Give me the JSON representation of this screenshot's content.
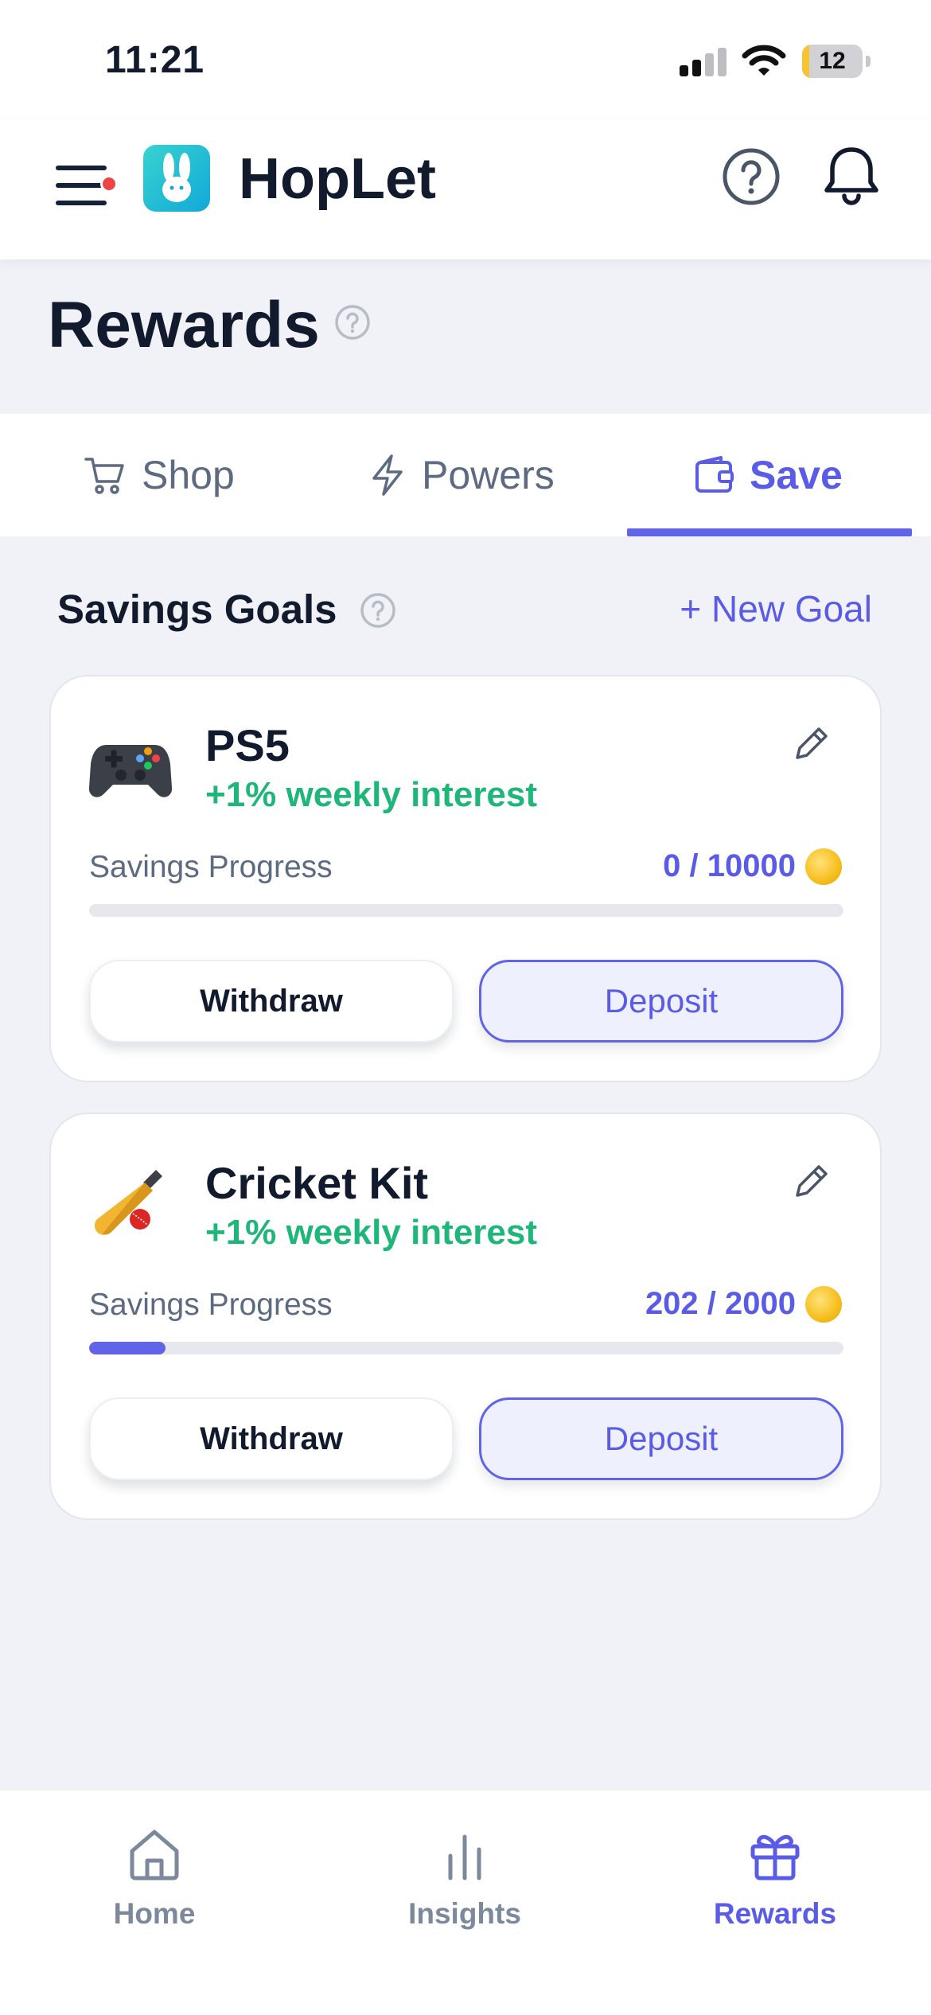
{
  "status_bar": {
    "time": "11:21",
    "battery_level": 12,
    "battery_text": "12"
  },
  "header": {
    "app_name": "HopLet",
    "menu_has_notification": true,
    "logo_colors": [
      "#38d3cf",
      "#11a9d8"
    ]
  },
  "page": {
    "title": "Rewards"
  },
  "tabs": [
    {
      "label": "Shop",
      "icon": "cart-icon",
      "active": false
    },
    {
      "label": "Powers",
      "icon": "lightning-icon",
      "active": false
    },
    {
      "label": "Save",
      "icon": "wallet-icon",
      "active": true
    }
  ],
  "savings": {
    "section_title": "Savings Goals",
    "new_goal_label": "+ New Goal",
    "goals": [
      {
        "name": "PS5",
        "icon": "gamepad-icon",
        "interest": "+1% weekly interest",
        "progress_label": "Savings Progress",
        "amount_text": "0 / 10000",
        "saved": 0,
        "target": 10000,
        "withdraw_label": "Withdraw",
        "deposit_label": "Deposit"
      },
      {
        "name": "Cricket Kit",
        "icon": "cricket-bat-icon",
        "interest": "+1% weekly interest",
        "progress_label": "Savings Progress",
        "amount_text": "202 / 2000",
        "saved": 202,
        "target": 2000,
        "withdraw_label": "Withdraw",
        "deposit_label": "Deposit"
      }
    ]
  },
  "bottom_nav": [
    {
      "label": "Home",
      "icon": "home-icon",
      "active": false
    },
    {
      "label": "Insights",
      "icon": "bar-chart-icon",
      "active": false
    },
    {
      "label": "Rewards",
      "icon": "gift-icon",
      "active": true
    }
  ],
  "colors": {
    "accent": "#5a5be6",
    "interest_green": "#1fb679",
    "notification_red": "#ef4444"
  }
}
